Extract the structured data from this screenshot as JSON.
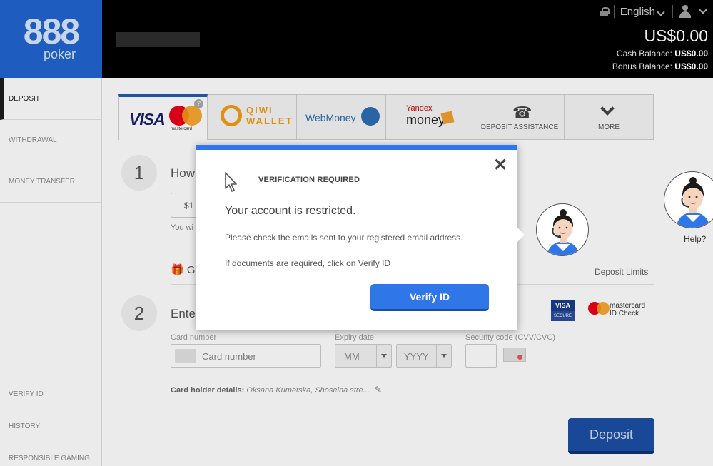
{
  "brand": {
    "logo_number": "888",
    "logo_word": "poker"
  },
  "header": {
    "language": "English",
    "balance": "US$0.00",
    "cash_label": "Cash Balance:",
    "cash_value": "US$0.00",
    "bonus_label": "Bonus Balance:",
    "bonus_value": "US$0.00"
  },
  "sidebar": {
    "top": [
      "DEPOSIT",
      "WITHDRAWAL",
      "MONEY TRANSFER"
    ],
    "bottom": [
      "VERIFY ID",
      "HISTORY",
      "RESPONSIBLE GAMING"
    ]
  },
  "tabs": {
    "visa": "VISA",
    "mastercard": "mastercard",
    "qiwi_line1": "QIWI",
    "qiwi_line2": "WALLET",
    "webmoney": "WebMoney",
    "yandex_small": "Yandex",
    "yandex_big": "money",
    "assistance": "DEPOSIT ASSISTANCE",
    "more": "MORE"
  },
  "form": {
    "step1_num": "1",
    "step1_title": "How",
    "amount_partial": "$1",
    "you_win_partial": "You wi",
    "gift_partial": "Gi",
    "deposit_limits": "Deposit Limits",
    "step2_num": "2",
    "step2_title": "Ente",
    "verified_by_visa": "VISA",
    "verified_sub": "SECURE",
    "mc_idcheck_1": "mastercard",
    "mc_idcheck_2": "ID Check",
    "card_number_label": "Card number",
    "card_number_placeholder": "Card number",
    "expiry_label": "Expiry date",
    "expiry_month": "MM",
    "expiry_year": "YYYY",
    "cvv_label": "Security code (CVV/CVC)",
    "holder_label": "Card holder details:",
    "holder_value": "Oksana Kumetska, Shoseina stre...",
    "deposit_button": "Deposit"
  },
  "modal": {
    "title": "VERIFICATION REQUIRED",
    "message": "Your account is restricted.",
    "line1": "Please check the emails sent to your registered email address.",
    "line2": "If documents are required, click on Verify ID",
    "button": "Verify ID"
  },
  "help": {
    "label": "Help?"
  },
  "colors": {
    "brand_blue": "#1e5dbf",
    "modal_accent": "#2f76e8",
    "deposit_btn": "#1c4fa3"
  }
}
